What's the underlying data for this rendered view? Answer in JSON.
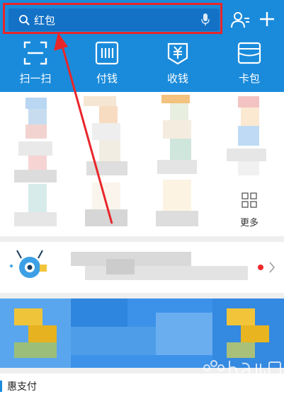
{
  "search": {
    "query": "红包"
  },
  "quick_actions": [
    {
      "label": "扫一扫",
      "icon": "scan-icon"
    },
    {
      "label": "付钱",
      "icon": "barcode-pay-icon"
    },
    {
      "label": "收钱",
      "icon": "yuan-receive-icon"
    },
    {
      "label": "卡包",
      "icon": "wallet-card-icon"
    }
  ],
  "grid": {
    "more_label": "更多"
  },
  "section": {
    "title": "惠支付"
  },
  "colors": {
    "header_blue": "#1a8bdb",
    "search_bg": "#1472c6",
    "highlight_red": "#e8262a",
    "notification_dot": "#f02828"
  }
}
